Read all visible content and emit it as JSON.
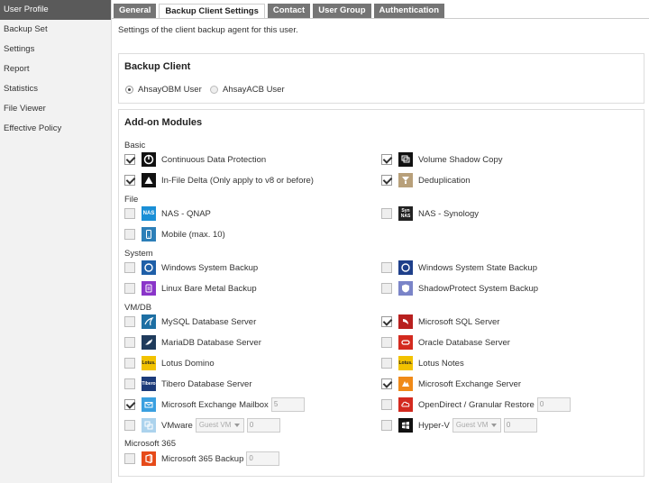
{
  "sidebar": {
    "items": [
      {
        "label": "User Profile",
        "active": true
      },
      {
        "label": "Backup Set"
      },
      {
        "label": "Settings"
      },
      {
        "label": "Report"
      },
      {
        "label": "Statistics"
      },
      {
        "label": "File Viewer"
      },
      {
        "label": "Effective Policy"
      }
    ]
  },
  "tabs": [
    {
      "label": "General"
    },
    {
      "label": "Backup Client Settings",
      "active": true
    },
    {
      "label": "Contact"
    },
    {
      "label": "User Group"
    },
    {
      "label": "Authentication"
    }
  ],
  "description": "Settings of the client backup agent for this user.",
  "backup_client": {
    "title": "Backup Client",
    "options": [
      {
        "label": "AhsayOBM User",
        "selected": true
      },
      {
        "label": "AhsayACB User",
        "selected": false
      }
    ]
  },
  "addon": {
    "title": "Add-on Modules",
    "groups": {
      "basic": "Basic",
      "file": "File",
      "system": "System",
      "vmdb": "VM/DB",
      "m365": "Microsoft 365"
    },
    "modules": {
      "cdp": {
        "label": "Continuous Data Protection",
        "checked": true,
        "icon": "cdp-icon"
      },
      "vss": {
        "label": "Volume Shadow Copy",
        "checked": true,
        "icon": "volume-icon"
      },
      "infile": {
        "label": "In-File Delta (Only apply to v8 or before)",
        "checked": true,
        "icon": "delta-icon"
      },
      "dedup": {
        "label": "Deduplication",
        "checked": true,
        "icon": "dedup-icon"
      },
      "qnap": {
        "label": "NAS - QNAP",
        "checked": false,
        "icon": "qnap-icon",
        "icon_text": "NAS"
      },
      "synology": {
        "label": "NAS - Synology",
        "checked": false,
        "icon": "synology-icon",
        "icon_text": "Syn NAS"
      },
      "mobile": {
        "label": "Mobile (max. 10)",
        "checked": false,
        "icon": "mobile-icon"
      },
      "winsys": {
        "label": "Windows System Backup",
        "checked": false,
        "icon": "windows-system-icon"
      },
      "winstate": {
        "label": "Windows System State Backup",
        "checked": false,
        "icon": "windows-state-icon"
      },
      "linux": {
        "label": "Linux Bare Metal Backup",
        "checked": false,
        "icon": "linux-icon"
      },
      "shadowprotect": {
        "label": "ShadowProtect System Backup",
        "checked": false,
        "icon": "shadowprotect-icon"
      },
      "mysql": {
        "label": "MySQL Database Server",
        "checked": false,
        "icon": "mysql-icon"
      },
      "mssql": {
        "label": "Microsoft SQL Server",
        "checked": true,
        "icon": "mssql-icon"
      },
      "mariadb": {
        "label": "MariaDB Database Server",
        "checked": false,
        "icon": "mariadb-icon"
      },
      "oracle": {
        "label": "Oracle Database Server",
        "checked": false,
        "icon": "oracle-icon"
      },
      "domino": {
        "label": "Lotus Domino",
        "checked": false,
        "icon": "lotus-icon",
        "icon_text": "Lotus."
      },
      "notes": {
        "label": "Lotus Notes",
        "checked": false,
        "icon": "lotus-notes-icon",
        "icon_text": "Lotus."
      },
      "tibero": {
        "label": "Tibero Database Server",
        "checked": false,
        "icon": "tibero-icon",
        "icon_text": "Tibero"
      },
      "exchange": {
        "label": "Microsoft Exchange Server",
        "checked": true,
        "icon": "exchange-icon"
      },
      "mailbox": {
        "label": "Microsoft Exchange Mailbox",
        "checked": true,
        "icon": "mailbox-icon",
        "count": "5"
      },
      "opendirect": {
        "label": "OpenDirect / Granular Restore",
        "checked": false,
        "icon": "opendirect-icon",
        "count": "0"
      },
      "vmware": {
        "label": "VMware",
        "checked": false,
        "icon": "vmware-icon",
        "select": "Guest VM",
        "count": "0"
      },
      "hyperv": {
        "label": "Hyper-V",
        "checked": false,
        "icon": "hyperv-icon",
        "select": "Guest VM",
        "count": "0"
      },
      "m365backup": {
        "label": "Microsoft 365 Backup",
        "checked": false,
        "icon": "office365-icon",
        "count": "0"
      }
    }
  },
  "colors": {
    "sidebar_active": "#5a5a5a",
    "tab_inactive": "#757575",
    "cdp": "#111111",
    "qnap": "#1a8fd6",
    "windows": "#1e5fa8",
    "linux": "#8a35c9",
    "mssql": "#b8201f",
    "oracle": "#d32a1f",
    "lotus": "#f2c200",
    "tibero": "#1c3b7a",
    "exchange": "#f08a18",
    "office365": "#e64a19"
  }
}
